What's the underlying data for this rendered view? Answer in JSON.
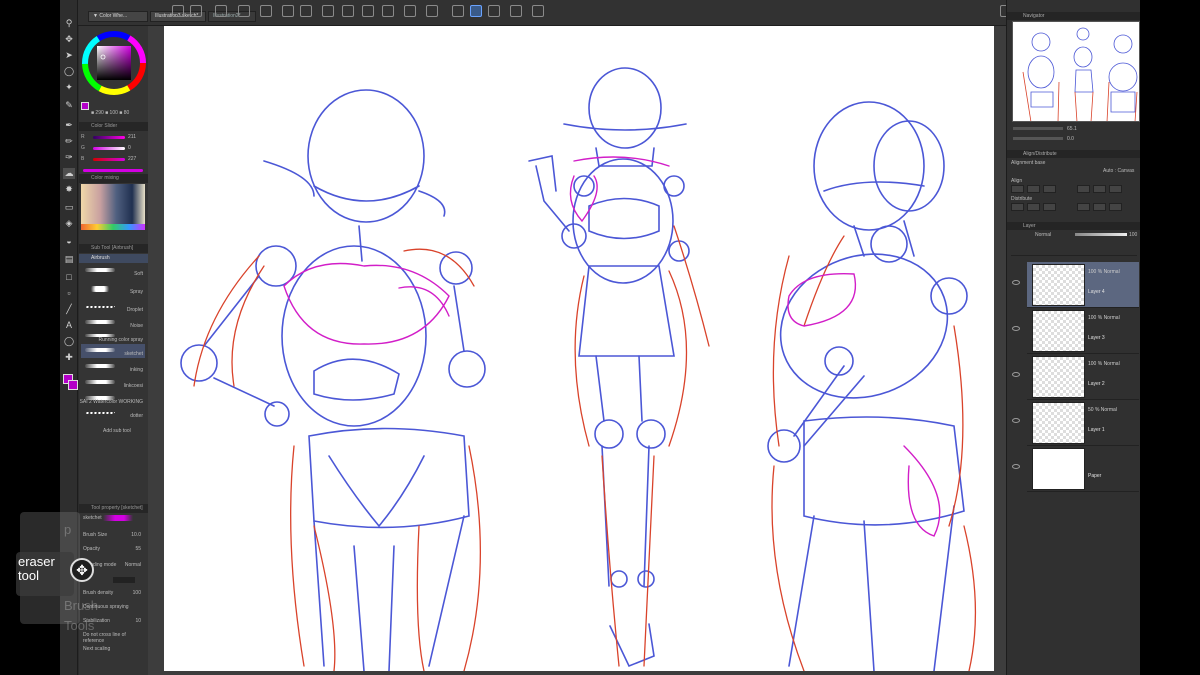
{
  "tabs": [
    {
      "label": "▼ Color Whe..."
    },
    {
      "label": "Illustration3 sketch*"
    },
    {
      "label": "Illustration2*"
    }
  ],
  "colors": {
    "foreground": "#b300c8",
    "accent": "#5c6780",
    "sketch_blue": "#4b57d6",
    "sketch_red": "#d9432b",
    "sketch_magenta": "#d21ec8"
  },
  "left_panel": {
    "color_wheel_readout": "■ 290 ■ 100 ■ 80",
    "color_slider_header": "Color Slider",
    "sliders": [
      {
        "label": "R",
        "value": "211"
      },
      {
        "label": "G",
        "value": "0"
      },
      {
        "label": "B",
        "value": "227"
      }
    ],
    "color_mixing_header": "Color mixing",
    "sub_tool_header": "Sub Tool [Airbrush]",
    "sub_tool_group": "Airbrush",
    "brushes": [
      {
        "name": "Soft"
      },
      {
        "name": "Spray"
      },
      {
        "name": "Droplet"
      },
      {
        "name": "Noise"
      },
      {
        "name": "Running color spray"
      },
      {
        "name": "sketchet"
      },
      {
        "name": "inking"
      },
      {
        "name": "linkcoesi"
      },
      {
        "name": "SAI 2 Watercolor WORKING"
      },
      {
        "name": "dotter"
      }
    ],
    "add_sub_tool": "Add sub tool",
    "tool_property_header": "Tool property [sketchet]",
    "tool_property_name": "sketchet",
    "props": [
      {
        "label": "Brush Size",
        "value": "10.0"
      },
      {
        "label": "Opacity",
        "value": "55"
      },
      {
        "label": "Blending mode",
        "value": "Normal"
      },
      {
        "label": "",
        "value": ""
      },
      {
        "label": "Brush density",
        "value": "100"
      },
      {
        "label": "Continuous spraying",
        "value": ""
      },
      {
        "label": "Stabilization",
        "value": "10"
      },
      {
        "label": "Do not cross line of reference",
        "value": ""
      },
      {
        "label": "Next scaling",
        "value": ""
      }
    ]
  },
  "overlay": {
    "tool_label": "eraser tool",
    "ghost_text_1": "Brush",
    "ghost_text_2": "Tools"
  },
  "right_panel": {
    "navigator_header": "Navigator",
    "zoom_value": "65.1",
    "rotate_value": "0.0",
    "align_header": "Align/Distribute",
    "alignment_base": "Alignment base",
    "align_mode": "Auto : Canvas",
    "align_label": "Align",
    "distribute_label": "Distribute",
    "layer_header": "Layer",
    "blend_mode": "Normal",
    "opacity_value": "100",
    "layers": [
      {
        "mode": "100 % Normal",
        "name": "Layer 4",
        "selected": true
      },
      {
        "mode": "100 % Normal",
        "name": "Layer 3",
        "selected": false
      },
      {
        "mode": "100 % Normal",
        "name": "Layer 2",
        "selected": false
      },
      {
        "mode": "50 % Normal",
        "name": "Layer 1",
        "selected": false
      },
      {
        "mode": "",
        "name": "Paper",
        "selected": false
      }
    ]
  }
}
